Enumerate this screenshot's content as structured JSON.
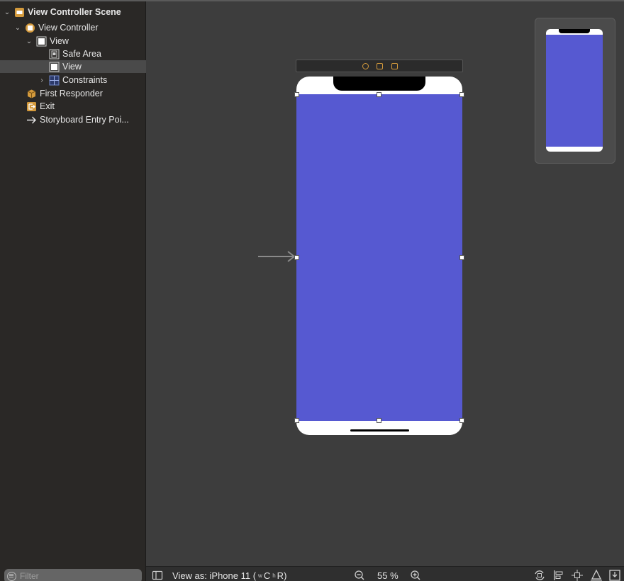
{
  "outline": {
    "items": [
      {
        "label": "View Controller Scene",
        "icon": "scene-icon",
        "chevron": "⌄"
      },
      {
        "label": "View Controller",
        "icon": "view-controller-icon",
        "chevron": "⌄"
      },
      {
        "label": "View",
        "icon": "view-icon",
        "chevron": "⌄"
      },
      {
        "label": "Safe Area",
        "icon": "safe-area-icon",
        "chevron": ""
      },
      {
        "label": "View",
        "icon": "view-icon",
        "chevron": "",
        "selected": true
      },
      {
        "label": "Constraints",
        "icon": "constraints-icon",
        "chevron": "›"
      },
      {
        "label": "First Responder",
        "icon": "first-responder-icon",
        "chevron": ""
      },
      {
        "label": "Exit",
        "icon": "exit-icon",
        "chevron": ""
      },
      {
        "label": "Storyboard Entry Poi...",
        "icon": "entry-point-arrow-icon",
        "chevron": ""
      }
    ]
  },
  "filter": {
    "placeholder": "Filter"
  },
  "bottombar": {
    "view_as_prefix": "View as: iPhone 11 (",
    "w_sub": "w",
    "w_class": "C",
    "h_sub": "h",
    "h_class": "R",
    "suffix": ")",
    "zoom": "55 %"
  },
  "colors": {
    "view_background": "#5659d1",
    "accent_icon": "#d49a3c"
  }
}
